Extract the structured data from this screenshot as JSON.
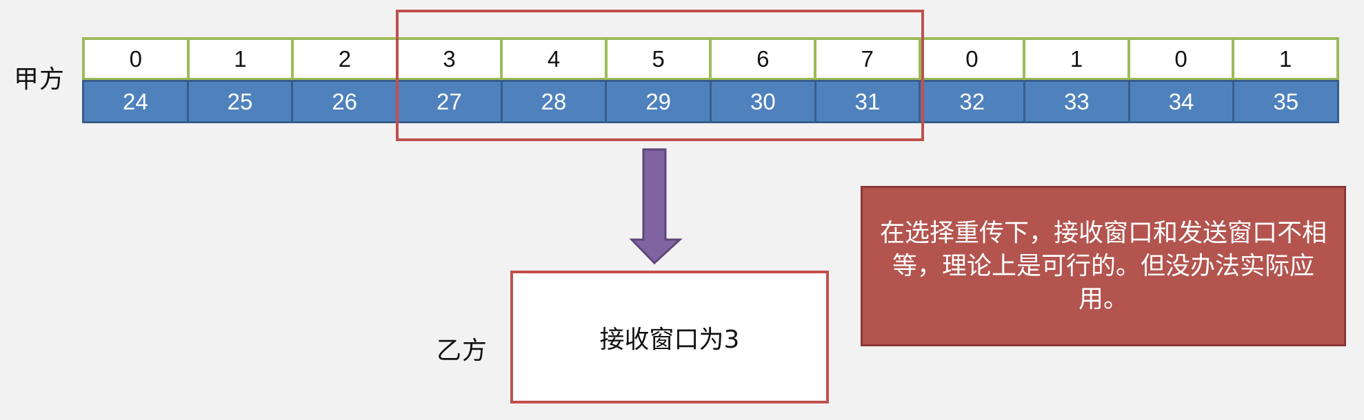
{
  "sender_label": "甲方",
  "receiver_label": "乙方",
  "sequence_numbers": [
    "0",
    "1",
    "2",
    "3",
    "4",
    "5",
    "6",
    "7",
    "0",
    "1",
    "0",
    "1"
  ],
  "frame_indices": [
    "24",
    "25",
    "26",
    "27",
    "28",
    "29",
    "30",
    "31",
    "32",
    "33",
    "34",
    "35"
  ],
  "receive_box_text": "接收窗口为3",
  "note_text": "在选择重传下，接收窗口和发送窗口不相等，理论上是可行的。但没办法实际应用。",
  "colors": {
    "background": "#f2f2f2",
    "sequence_border": "#9bbb59",
    "index_fill": "#4f81bd",
    "window_border": "#c0504d",
    "arrow_fill": "#8064a2",
    "note_fill": "#b3544f"
  }
}
